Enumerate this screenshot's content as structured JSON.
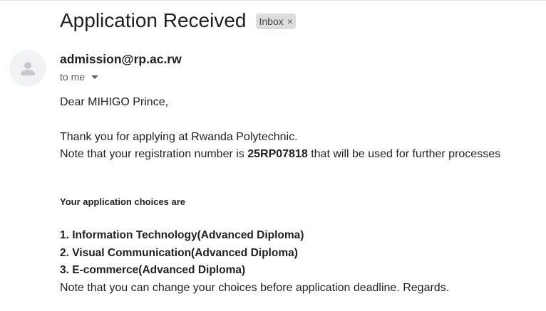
{
  "email": {
    "subject": "Application Received",
    "label_chip": "Inbox",
    "label_chip_close": "×",
    "sender": "admission@rp.ac.rw",
    "recipient": "to me",
    "greeting": "Dear MIHIGO Prince,",
    "thanks_line": "Thank you for applying at Rwanda Polytechnic.",
    "reg_prefix": "Note that your registration number is ",
    "reg_number": "25RP07818",
    "reg_suffix": " that will be used for further processes",
    "choices_heading": "Your application choices are",
    "choices": [
      "1. Information Technology(Advanced Diploma)",
      "2. Visual Communication(Advanced Diploma)",
      "3. E-commerce(Advanced Diploma)"
    ],
    "closing": "Note that you can change your choices before application deadline. Regards."
  },
  "icons": {
    "avatar": "default-person-avatar-icon",
    "recipient_dropdown": "caret-down-icon",
    "chip_close": "close-icon"
  },
  "colors": {
    "chip_background": "#dddddd",
    "avatar_background": "#f1f3f4",
    "avatar_silhouette": "#c7c9cc"
  }
}
